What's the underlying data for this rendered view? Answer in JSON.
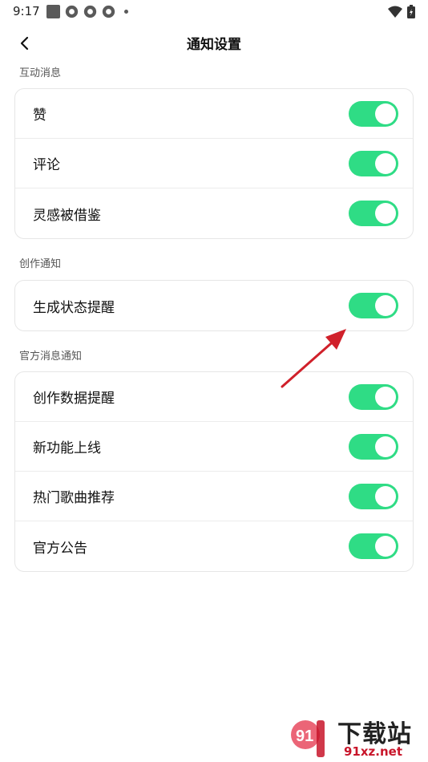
{
  "status": {
    "time": "9:17"
  },
  "header": {
    "title": "通知设置"
  },
  "sections": [
    {
      "label": "互动消息",
      "items": [
        {
          "label": "赞",
          "on": true
        },
        {
          "label": "评论",
          "on": true
        },
        {
          "label": "灵感被借鉴",
          "on": true
        }
      ]
    },
    {
      "label": "创作通知",
      "items": [
        {
          "label": "生成状态提醒",
          "on": true
        }
      ]
    },
    {
      "label": "官方消息通知",
      "items": [
        {
          "label": "创作数据提醒",
          "on": true
        },
        {
          "label": "新功能上线",
          "on": true
        },
        {
          "label": "热门歌曲推荐",
          "on": true
        },
        {
          "label": "官方公告",
          "on": true
        }
      ]
    }
  ],
  "watermark": {
    "title": "下载站",
    "site": "91xz.net",
    "logo_text": "91"
  },
  "colors": {
    "toggle_on": "#2fdc85",
    "annotation_arrow": "#d0202a"
  }
}
